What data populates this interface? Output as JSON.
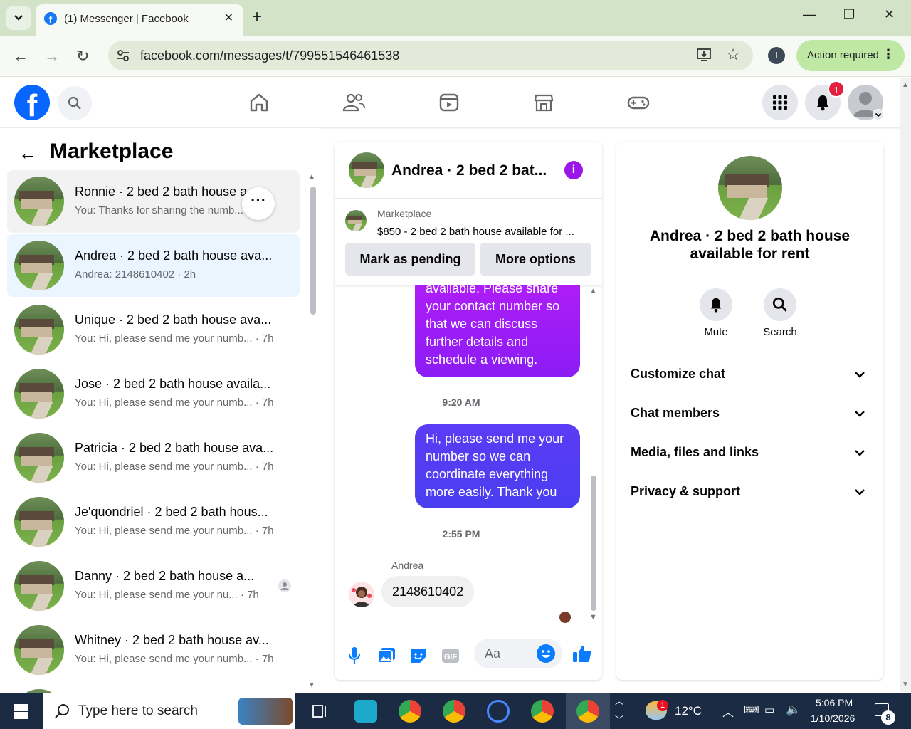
{
  "browser": {
    "tab_title": "(1) Messenger | Facebook",
    "url": "facebook.com/messages/t/799551546461538",
    "profile_initial": "I",
    "action_required": "Action required"
  },
  "fb": {
    "notif_count": "1"
  },
  "left": {
    "title": "Marketplace",
    "conversations": [
      {
        "name": "Ronnie · 2 bed 2 bath house a...",
        "snippet": "You: Thanks for sharing the numb... · 1m",
        "state": "hover"
      },
      {
        "name": "Andrea · 2 bed 2 bath house ava...",
        "snippet": "Andrea: 2148610402 · 2h",
        "state": "selected"
      },
      {
        "name": "Unique · 2 bed 2 bath house ava...",
        "snippet": "You: Hi, please send me your numb... · 7h",
        "state": ""
      },
      {
        "name": "Jose · 2 bed 2 bath house availa...",
        "snippet": "You: Hi, please send me your numb... · 7h",
        "state": ""
      },
      {
        "name": "Patricia · 2 bed 2 bath house ava...",
        "snippet": "You: Hi, please send me your numb... · 7h",
        "state": ""
      },
      {
        "name": "Je'quondriel · 2 bed 2 bath hous...",
        "snippet": "You: Hi, please send me your numb... · 7h",
        "state": ""
      },
      {
        "name": "Danny · 2 bed 2 bath house a...",
        "snippet": "You: Hi, please send me your nu... · 7h",
        "state": ""
      },
      {
        "name": "Whitney · 2 bed 2 bath house av...",
        "snippet": "You: Hi, please send me your numb... · 7h",
        "state": ""
      }
    ]
  },
  "chat": {
    "header_name": "Andrea · 2 bed 2 bat...",
    "listing_source": "Marketplace",
    "listing_desc": "$850 - 2 bed 2 bath house available for ...",
    "mark_pending": "Mark as pending",
    "more_options": "More options",
    "msg1": "available. Please share your contact number so that we can discuss further details and schedule a viewing.",
    "time1": "9:20 AM",
    "msg2": "Hi, please send me your number so we can coordinate everything more easily. Thank you",
    "time2": "2:55 PM",
    "sender": "Andrea",
    "msg3": "2148610402",
    "composer_placeholder": "Aa"
  },
  "info": {
    "title": "Andrea · 2 bed 2 bath house available for rent",
    "mute": "Mute",
    "search": "Search",
    "sections": [
      "Customize chat",
      "Chat members",
      "Media, files and links",
      "Privacy & support"
    ]
  },
  "taskbar": {
    "search_placeholder": "Type here to search",
    "weather": "12°C",
    "time": "5:06 PM",
    "date": "1/10/2026",
    "notif_count": "8",
    "weather_badge": "1"
  }
}
